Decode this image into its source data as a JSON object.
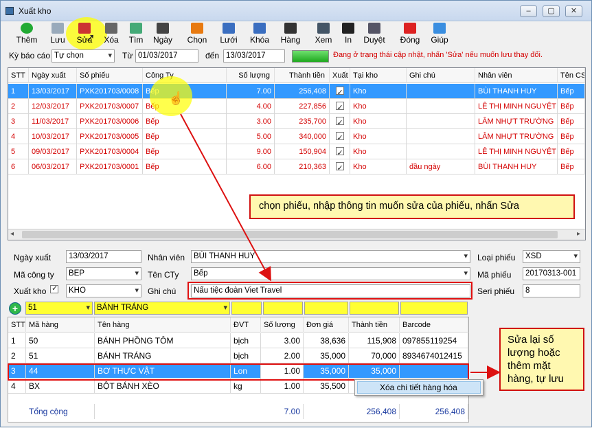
{
  "window": {
    "title": "Xuất kho"
  },
  "toolbar": [
    {
      "name": "add",
      "label": "Thêm",
      "color": "#22aa33"
    },
    {
      "name": "save",
      "label": "Lưu",
      "color": "#9ab"
    },
    {
      "name": "edit",
      "label": "Sửa",
      "color": "#cc3333"
    },
    {
      "name": "delete",
      "label": "Xóa",
      "color": "#666"
    },
    {
      "name": "find",
      "label": "Tìm",
      "color": "#4a7"
    },
    {
      "name": "date",
      "label": "Ngày",
      "color": "#444"
    },
    {
      "name": "select",
      "label": "Chọn",
      "color": "#e87a10"
    },
    {
      "name": "grid",
      "label": "Lưới",
      "color": "#3a6ec0"
    },
    {
      "name": "lock",
      "label": "Khóa",
      "color": "#3a6ec0"
    },
    {
      "name": "goods",
      "label": "Hàng",
      "color": "#333"
    },
    {
      "name": "view",
      "label": "Xem",
      "color": "#456"
    },
    {
      "name": "print",
      "label": "In",
      "color": "#222"
    },
    {
      "name": "approve",
      "label": "Duyệt",
      "color": "#556"
    },
    {
      "name": "close",
      "label": "Đóng",
      "color": "#dd2222"
    },
    {
      "name": "help",
      "label": "Giúp",
      "color": "#3a8ee0"
    }
  ],
  "filter": {
    "period_label": "Kỳ báo cáo",
    "period_value": "Tự chọn",
    "from_label": "Từ",
    "from_value": "01/03/2017",
    "to_label": "đến",
    "to_value": "13/03/2017",
    "status": "Đang ở trạng thái cập nhật, nhấn 'Sửa' nếu muốn lưu thay đổi."
  },
  "vouchers": {
    "columns": [
      "STT",
      "Ngày xuất",
      "Số phiếu",
      "Công Ty",
      "Số lượng",
      "Thành tiền",
      "Xuất",
      "Tại kho",
      "Ghi chú",
      "Nhân viên",
      "Tên CS"
    ],
    "rows": [
      {
        "stt": "1",
        "date": "13/03/2017",
        "no": "PXK201703/0008",
        "company": "Bếp",
        "qty": "7.00",
        "amount": "256,408",
        "store": "Kho",
        "note": "",
        "staff": "BÙI THANH HUY",
        "cs": "Bếp"
      },
      {
        "stt": "2",
        "date": "12/03/2017",
        "no": "PXK201703/0007",
        "company": "Bếp",
        "qty": "4.00",
        "amount": "227,856",
        "store": "Kho",
        "note": "",
        "staff": "LÊ THỊ MINH NGUYỆT",
        "cs": "Bếp"
      },
      {
        "stt": "3",
        "date": "11/03/2017",
        "no": "PXK201703/0006",
        "company": "Bếp",
        "qty": "3.00",
        "amount": "235,700",
        "store": "Kho",
        "note": "",
        "staff": "LÂM NHỰT TRƯỜNG",
        "cs": "Bếp"
      },
      {
        "stt": "4",
        "date": "10/03/2017",
        "no": "PXK201703/0005",
        "company": "Bếp",
        "qty": "5.00",
        "amount": "340,000",
        "store": "Kho",
        "note": "",
        "staff": "LÂM NHỰT TRƯỜNG",
        "cs": "Bếp"
      },
      {
        "stt": "5",
        "date": "09/03/2017",
        "no": "PXK201703/0004",
        "company": "Bếp",
        "qty": "9.00",
        "amount": "150,904",
        "store": "Kho",
        "note": "",
        "staff": "LÊ THỊ MINH NGUYỆT",
        "cs": "Bếp"
      },
      {
        "stt": "6",
        "date": "06/03/2017",
        "no": "PXK201703/0001",
        "company": "Bếp",
        "qty": "6.00",
        "amount": "210,363",
        "store": "Kho",
        "note": "đầu ngày",
        "staff": "BÙI THANH HUY",
        "cs": "Bếp"
      }
    ]
  },
  "callout1": "chọn phiếu, nhập thông tin muốn sửa của phiếu, nhấn Sửa",
  "form": {
    "date_label": "Ngày xuất",
    "date_value": "13/03/2017",
    "staff_label": "Nhân viên",
    "staff_value": "BÙI THANH HUY",
    "type_label": "Loại phiếu",
    "type_value": "XSD",
    "company_code_label": "Mã công ty",
    "company_code_value": "BEP",
    "company_name_label": "Tên CTy",
    "company_name_value": "Bếp",
    "voucher_code_label": "Mã phiếu",
    "voucher_code_value": "20170313-001",
    "export_label": "Xuất kho",
    "store_value": "KHO",
    "note_label": "Ghi chú",
    "note_value": "Nấu tiệc đoàn Viet Travel",
    "serial_label": "Seri phiếu",
    "serial_value": "8"
  },
  "entry": {
    "code": "51",
    "name": "BÁNH TRÁNG"
  },
  "details": {
    "columns": [
      "STT",
      "Mã hàng",
      "Tên hàng",
      "ĐVT",
      "Số lượng",
      "Đơn giá",
      "Thành tiền",
      "Barcode"
    ],
    "rows": [
      {
        "stt": "1",
        "code": "50",
        "name": "BÁNH PHỒNG TÔM",
        "unit": "bịch",
        "qty": "3.00",
        "price": "38,636",
        "amount": "115,908",
        "barcode": "097855119254"
      },
      {
        "stt": "2",
        "code": "51",
        "name": "BÁNH TRÁNG",
        "unit": "bịch",
        "qty": "2.00",
        "price": "35,000",
        "amount": "70,000",
        "barcode": "8934674012415"
      },
      {
        "stt": "3",
        "code": "44",
        "name": "BƠ THỰC VẬT",
        "unit": "Lon",
        "qty": "1.00",
        "price": "35,000",
        "amount": "35,000",
        "barcode": ""
      },
      {
        "stt": "4",
        "code": "BX",
        "name": "BỘT BÁNH XÈO",
        "unit": "kg",
        "qty": "1.00",
        "price": "35,500",
        "amount": "",
        "barcode": ""
      }
    ],
    "total_label": "Tổng cộng",
    "total_qty": "7.00",
    "total_amount1": "256,408",
    "total_amount2": "256,408"
  },
  "context_menu": "Xóa chi tiết hàng hóa",
  "callout2": "Sửa lại số lượng hoặc thêm mặt hàng, tự lưu"
}
